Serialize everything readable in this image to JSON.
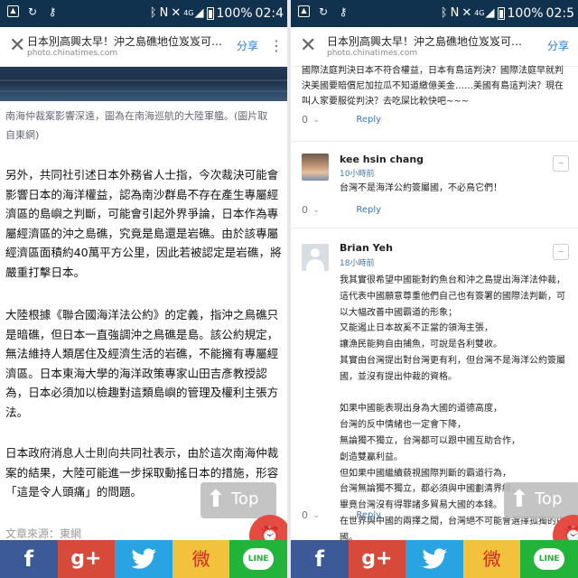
{
  "status_bar": {
    "network": "4G",
    "network_sub": "LTE",
    "battery": "100%",
    "time_left": "02:4",
    "time_right": "02:5"
  },
  "article": {
    "title": "日本別高興太早！沖之島礁地位岌岌可…",
    "url": "photo.chinatimes.com",
    "share_label": "分享",
    "caption": "南海仲裁案影響深遠，圖為在南海巡航的大陸軍艦。(圖片取自東網)",
    "paragraphs": [
      "另外，共同社引述日本外務省人士指，今次裁決可能會影響日本的海洋權益，認為南沙群島不存在產生專屬經濟區的島嶼之判斷，可能會引起外界爭論，日本作為專屬經濟區的沖之島礁，究竟是島還是岩礁。由於該專屬經濟區面積約40萬平方公里，因此若被認定是岩礁，將嚴重打擊日本。",
      "大陸根據《聯合國海洋法公約》的定義，指沖之鳥礁只是暗礁，但日本一直強調沖之鳥礁是島。該公約規定，無法維持人類居住及經濟生活的岩礁，不能擁有專屬經濟區。日本東海大學的海洋政策專家山田吉彥教授認為，日本必須加以檢趣對這類島嶼的管理及權利主張方法。",
      "日本政府消息人士則向共同社表示，由於這次南海仲裁案的結果，大陸可能進一步採取動搖日本的措施，形容「這是令人頭痛」的問題。"
    ],
    "source": "文章來源：東網",
    "top_button": "Top"
  },
  "share_bar": {
    "facebook": "f",
    "google_plus": "g+",
    "weibo": "微",
    "line": "LINE"
  },
  "comments": {
    "top_text": "國際法庭判決日本不符合權益，日本有島這判決？國際法庭早就判決美國要賠償尼加拉瓜不知道繳億美金……美國有島這判決？現在叫人家要服從判決？去吃屎比較快吧~~~",
    "reply_label": "Reply",
    "items": [
      {
        "name": "kee hsin chang",
        "time": "10小時前",
        "body": "台灣不是海洋公約簽屬國，不必鳥它們！",
        "votes": "0"
      },
      {
        "name": "Brian Yeh",
        "time": "18小時前",
        "body": "我其實很希望中國能對釣魚台和沖之島提出海洋法仲裁，這代表中國願意尊重他們自己也有簽署的國際法判斷，可以大幅改善中國霸道的形象；\n又能遏止日本故奚不正當的領海主張，\n讓漁民能夠自由捕魚，可說是各利雙收。\n其實由台灣提出對台灣更有利，但台灣不是海洋公約簽屬國，並沒有提出仲裁的資格。\n\n如果中國能表現出身為大國的道德高度，\n台灣的反中情緒也一定會下降，\n無論獨不獨立，台灣都可以跟中國互助合作，\n創造雙贏利益。\n但如果中國繼續藐視國際判斷的霸道行為，\n台灣無論獨不獨立，都必須與中國劃清界線，\n畢竟台灣沒有得罪諸多貿易大國的本錢。\n在世界與中國的兩擇之間，台灣絕不可能會選擇孤獨的中國。",
        "votes": "0"
      }
    ],
    "first_votes": "0"
  }
}
